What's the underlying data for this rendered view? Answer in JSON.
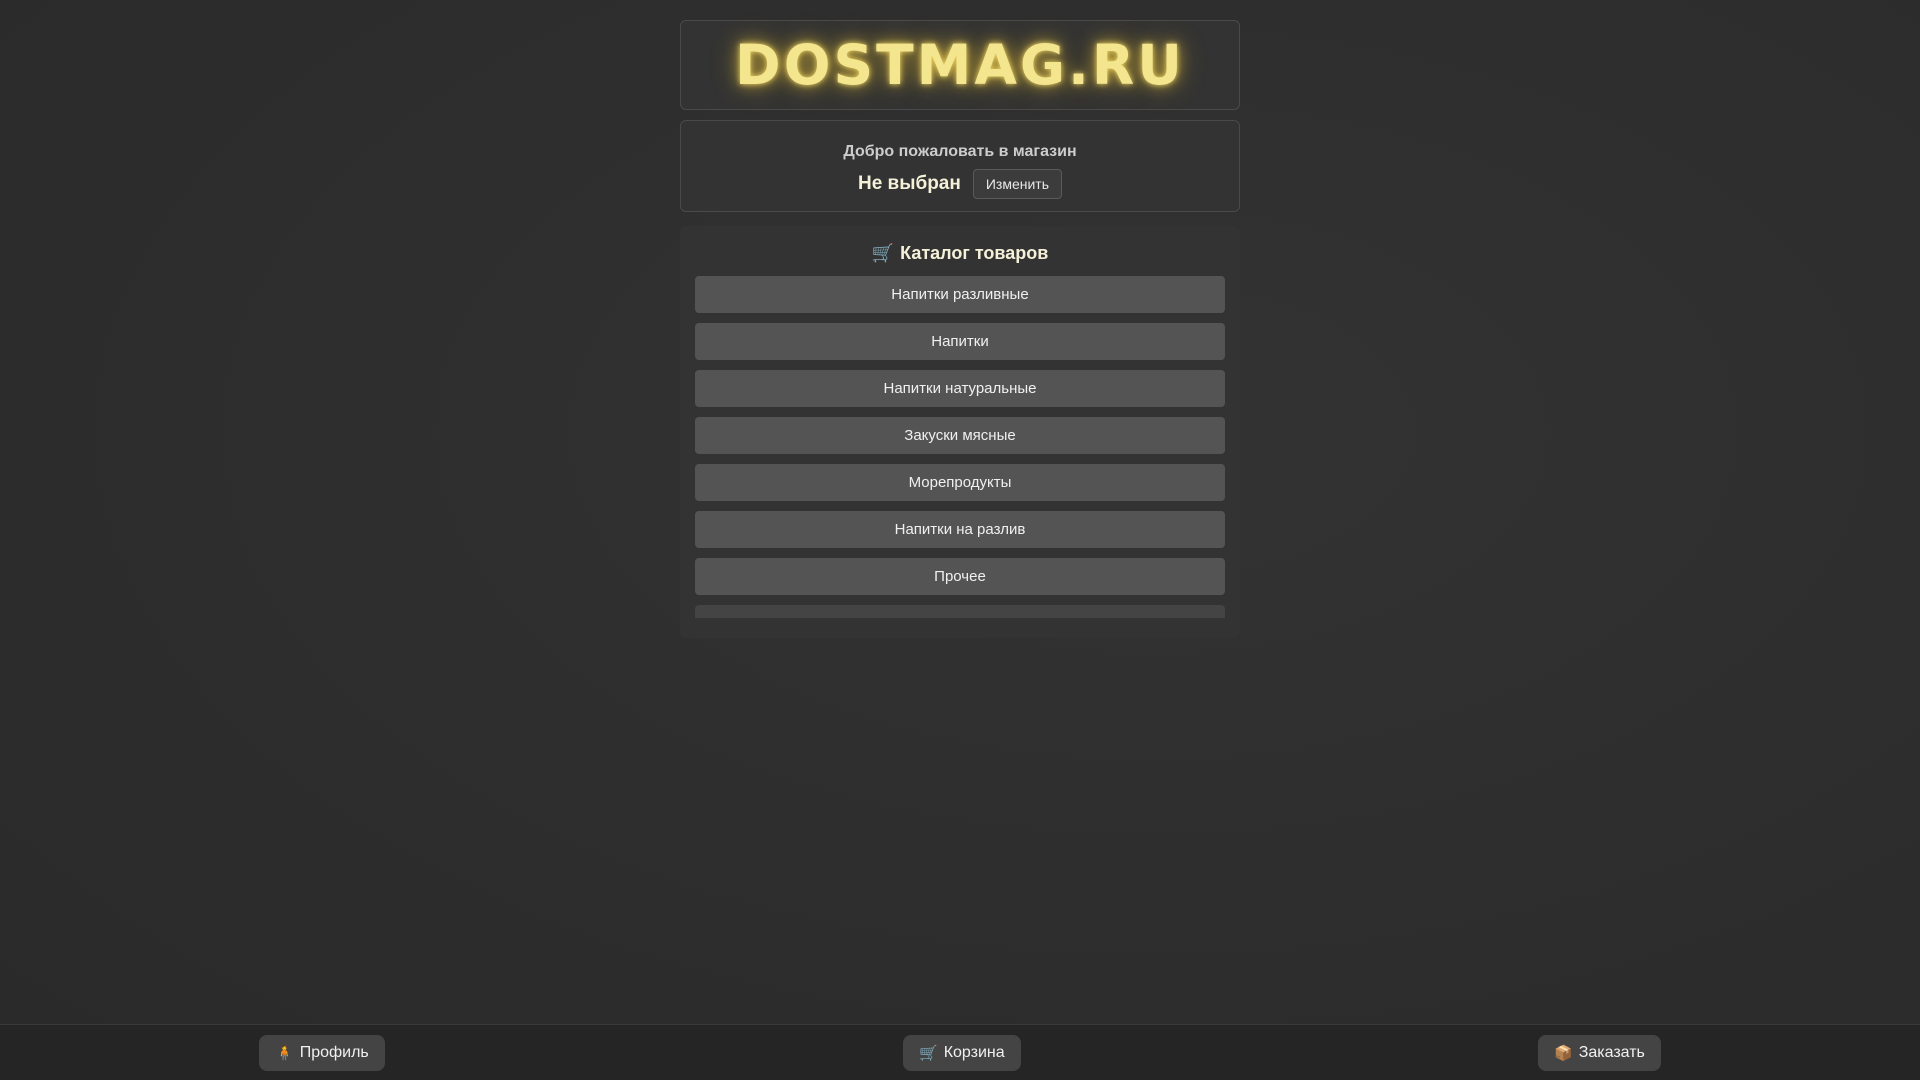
{
  "header": {
    "logo_text": "DOSTMAG.RU",
    "logo_color": "#f4e68e"
  },
  "store_panel": {
    "welcome_text": "Добро пожаловать в магазин",
    "store_name": "Не выбран",
    "change_label": "Изменить"
  },
  "catalog": {
    "title": "Каталог товаров",
    "title_icon": "cart-icon",
    "categories": [
      {
        "label": "Напитки разливные"
      },
      {
        "label": "Напитки"
      },
      {
        "label": "Напитки натуральные"
      },
      {
        "label": "Закуски мясные"
      },
      {
        "label": "Морепродукты"
      },
      {
        "label": "Напитки на разлив"
      },
      {
        "label": "Прочее"
      }
    ]
  },
  "bottom_nav": {
    "profile": {
      "label": "Профиль",
      "icon": "person-icon"
    },
    "cart": {
      "label": "Корзина",
      "icon": "cart-icon"
    },
    "order": {
      "label": "Заказать",
      "icon": "package-icon"
    }
  }
}
